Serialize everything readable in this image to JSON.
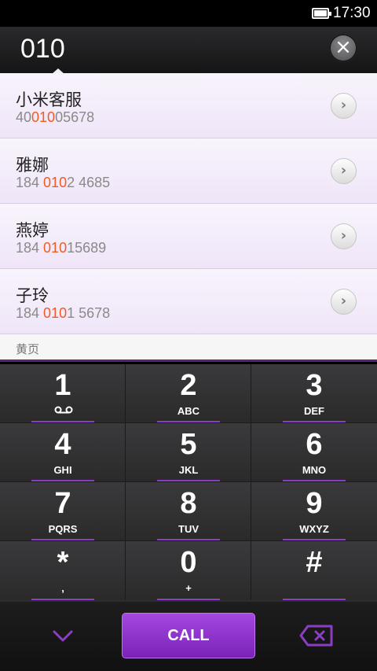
{
  "status_bar": {
    "time": "17:30"
  },
  "dialer": {
    "number": "010",
    "clear_icon": "close-icon"
  },
  "contacts": [
    {
      "name": "小米客服",
      "number_pre": "40",
      "number_match": "010",
      "number_post": "05678"
    },
    {
      "name": "雅娜",
      "number_pre": "184 ",
      "number_match": "010",
      "number_post": "2 4685"
    },
    {
      "name": "燕婷",
      "number_pre": "184 ",
      "number_match": "010",
      "number_post": "15689"
    },
    {
      "name": "子玲",
      "number_pre": "184 ",
      "number_match": "010",
      "number_post": "1 5678"
    }
  ],
  "yellow_pages_label": "黄页",
  "keypad": [
    {
      "digit": "1",
      "letters": ""
    },
    {
      "digit": "2",
      "letters": "ABC"
    },
    {
      "digit": "3",
      "letters": "DEF"
    },
    {
      "digit": "4",
      "letters": "GHI"
    },
    {
      "digit": "5",
      "letters": "JKL"
    },
    {
      "digit": "6",
      "letters": "MNO"
    },
    {
      "digit": "7",
      "letters": "PQRS"
    },
    {
      "digit": "8",
      "letters": "TUV"
    },
    {
      "digit": "9",
      "letters": "WXYZ"
    },
    {
      "digit": "*",
      "letters": ","
    },
    {
      "digit": "0",
      "letters": "+"
    },
    {
      "digit": "#",
      "letters": ""
    }
  ],
  "bottom_bar": {
    "call_label": "CALL"
  },
  "colors": {
    "accent": "#8a3ec4",
    "match_highlight": "#f15a22",
    "call_button": "#9235d0"
  }
}
